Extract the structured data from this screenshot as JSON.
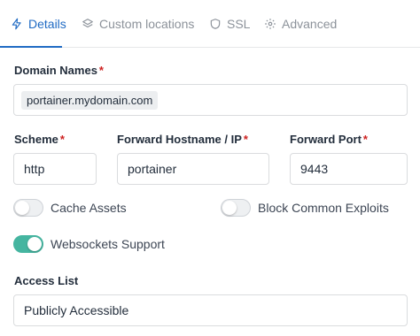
{
  "tabs": [
    {
      "label": "Details",
      "icon": "zap-icon",
      "active": true
    },
    {
      "label": "Custom locations",
      "icon": "layers-icon",
      "active": false
    },
    {
      "label": "SSL",
      "icon": "shield-icon",
      "active": false
    },
    {
      "label": "Advanced",
      "icon": "gear-icon",
      "active": false
    }
  ],
  "form": {
    "domain_names": {
      "label": "Domain Names",
      "required": "*",
      "chip": "portainer.mydomain.com"
    },
    "scheme": {
      "label": "Scheme",
      "required": "*",
      "value": "http"
    },
    "forward_hostname": {
      "label": "Forward Hostname / IP",
      "required": "*",
      "value": "portainer"
    },
    "forward_port": {
      "label": "Forward Port",
      "required": "*",
      "value": "9443"
    },
    "cache_assets": {
      "label": "Cache Assets",
      "enabled": false
    },
    "block_exploits": {
      "label": "Block Common Exploits",
      "enabled": false
    },
    "websockets": {
      "label": "Websockets Support",
      "enabled": true
    },
    "access_list": {
      "label": "Access List",
      "value": "Publicly Accessible"
    }
  },
  "colors": {
    "accent": "#206bc4",
    "toggle_on": "#45b5a0",
    "required": "#cd201f"
  }
}
